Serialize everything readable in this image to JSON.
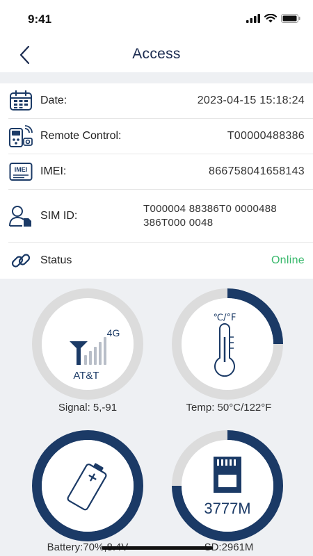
{
  "status_bar": {
    "time": "9:41"
  },
  "nav": {
    "title": "Access"
  },
  "info": {
    "date": {
      "label": "Date:",
      "value": "2023-04-15 15:18:24"
    },
    "remote": {
      "label": "Remote Control:",
      "value": "T00000488386"
    },
    "imei": {
      "label": "IMEI:",
      "value": "866758041658143",
      "icon_text": "IMEI"
    },
    "sim": {
      "label": "SIM ID:",
      "value": "T000004 88386T0 0000488 386T000 0048"
    },
    "status": {
      "label": "Status",
      "value": "Online"
    }
  },
  "gauges": {
    "signal": {
      "caption": "Signal: 5,-91",
      "carrier": "AT&T",
      "network": "4G"
    },
    "temp": {
      "caption": "Temp: 50°C/122°F",
      "unit": "℃/°F"
    },
    "battery": {
      "caption": "Battery:70%,8.4V",
      "level": 0.7
    },
    "sd": {
      "caption": "SD:2961M",
      "total": "3777M"
    }
  },
  "colors": {
    "accent": "#1b3a66",
    "ring_track": "#dcdcdc",
    "online": "#37b86b",
    "background": "#eef0f3"
  }
}
